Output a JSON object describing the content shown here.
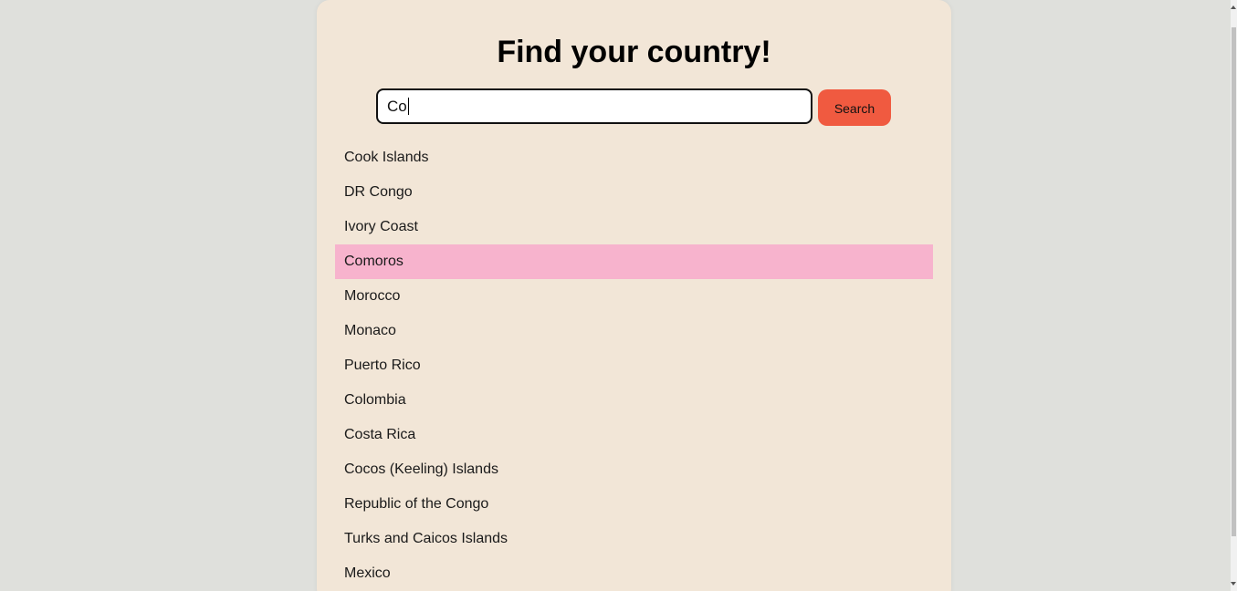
{
  "header": {
    "title": "Find your country!"
  },
  "search": {
    "value": "Co",
    "button_label": "Search"
  },
  "results": {
    "highlighted_index": 3,
    "highlight_color": "#f7b3cd",
    "items": [
      "Cook Islands",
      "DR Congo",
      "Ivory Coast",
      "Comoros",
      "Morocco",
      "Monaco",
      "Puerto Rico",
      "Colombia",
      "Costa Rica",
      "Cocos (Keeling) Islands",
      "Republic of the Congo",
      "Turks and Caicos Islands",
      "Mexico"
    ]
  },
  "colors": {
    "background": "#dfe0dc",
    "card": "#f2e6d7",
    "accent_button": "#f05a40"
  }
}
